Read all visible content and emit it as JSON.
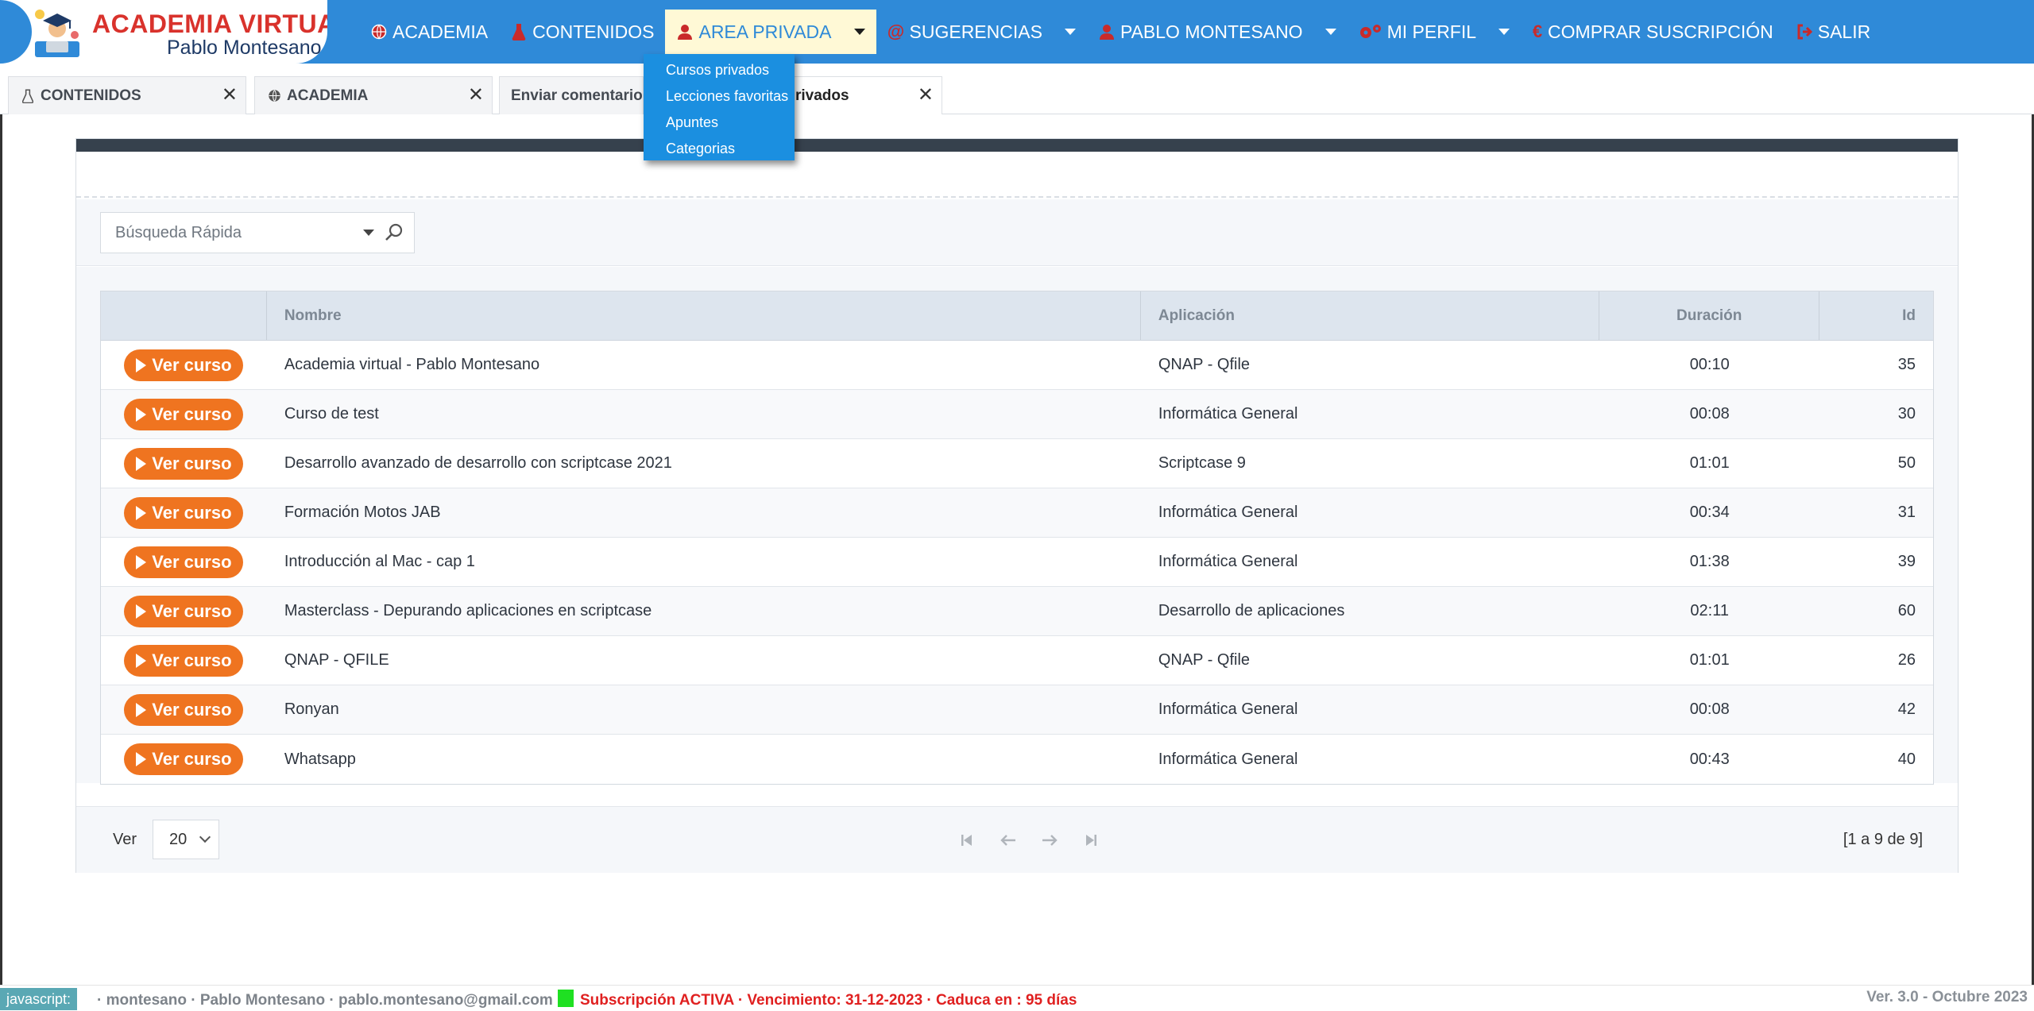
{
  "logo": {
    "title": "ACADEMIA VIRTUAL",
    "subtitle": "Pablo Montesano"
  },
  "nav": {
    "items": [
      {
        "label": "ACADEMIA",
        "icon": "globe-icon"
      },
      {
        "label": "CONTENIDOS",
        "icon": "flask-icon"
      },
      {
        "label": "AREA PRIVADA",
        "icon": "teacher-icon",
        "active": true
      },
      {
        "label": "SUGERENCIAS",
        "icon": "at-icon"
      },
      {
        "label": "PABLO MONTESANO",
        "icon": "user-icon"
      },
      {
        "label": "MI PERFIL",
        "icon": "gears-icon"
      },
      {
        "label": "COMPRAR SUSCRIPCIÓN",
        "icon": "euro-icon"
      },
      {
        "label": "SALIR",
        "icon": "logout-icon"
      }
    ]
  },
  "dropdown": {
    "items": [
      "Cursos privados",
      "Lecciones favoritas",
      "Apuntes",
      "Categorias"
    ]
  },
  "tabs": {
    "items": [
      {
        "label": "CONTENIDOS"
      },
      {
        "label": "ACADEMIA"
      },
      {
        "label": "Enviar comentario"
      },
      {
        "label": "rivados"
      }
    ]
  },
  "search": {
    "placeholder": "Búsqueda Rápida"
  },
  "grid": {
    "columns": [
      "",
      "Nombre",
      "Aplicación",
      "Duración",
      "Id"
    ],
    "button_label": "Ver curso",
    "rows": [
      {
        "nombre": "Academia virtual - Pablo Montesano",
        "aplicacion": "QNAP - Qfile",
        "duracion": "00:10",
        "id": "35"
      },
      {
        "nombre": "Curso de test",
        "aplicacion": "Informática General",
        "duracion": "00:08",
        "id": "30"
      },
      {
        "nombre": "Desarrollo avanzado de desarrollo con scriptcase 2021",
        "aplicacion": "Scriptcase 9",
        "duracion": "01:01",
        "id": "50"
      },
      {
        "nombre": "Formación Motos JAB",
        "aplicacion": "Informática General",
        "duracion": "00:34",
        "id": "31"
      },
      {
        "nombre": "Introducción al Mac - cap 1",
        "aplicacion": "Informática General",
        "duracion": "01:38",
        "id": "39"
      },
      {
        "nombre": "Masterclass - Depurando aplicaciones en scriptcase",
        "aplicacion": "Desarrollo de aplicaciones",
        "duracion": "02:11",
        "id": "60"
      },
      {
        "nombre": "QNAP - QFILE",
        "aplicacion": "QNAP - Qfile",
        "duracion": "01:01",
        "id": "26"
      },
      {
        "nombre": "Ronyan",
        "aplicacion": "Informática General",
        "duracion": "00:08",
        "id": "42"
      },
      {
        "nombre": "Whatsapp",
        "aplicacion": "Informática General",
        "duracion": "00:43",
        "id": "40"
      }
    ]
  },
  "footer": {
    "ver_label": "Ver",
    "page_size": "20",
    "range": "[1 a 9 de 9]"
  },
  "status": {
    "js_tag": "javascript:",
    "user_info": "· montesano · Pablo Montesano · pablo.montesano@gmail.com",
    "subscription": "Subscripción ACTIVA · Vencimiento: 31-12-2023 · Caduca en : 95 días",
    "version": "Ver. 3.0 - Octubre 2023"
  },
  "colors": {
    "nav_blue": "#2f8ad8",
    "dropdown_blue": "#1b8fe0",
    "button_orange": "#ef7420",
    "logo_red": "#d9322c",
    "status_red": "#e02020",
    "status_green": "#1fe022"
  }
}
